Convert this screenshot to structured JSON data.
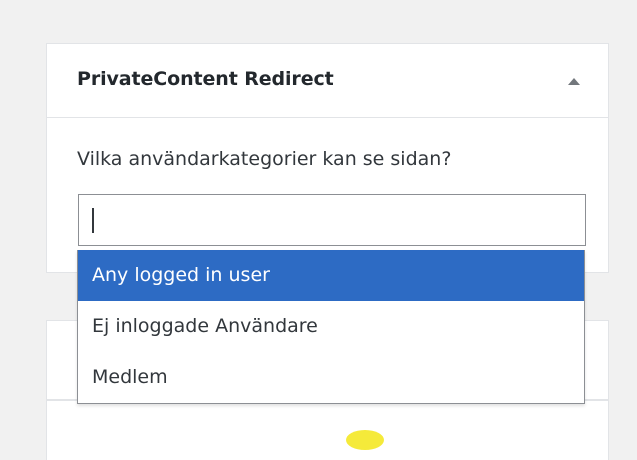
{
  "panel": {
    "title": "PrivateContent Redirect",
    "toggle_icon": "triangle-up-icon"
  },
  "field": {
    "question": "Vilka användarkategorier kan se sidan?",
    "search_value": ""
  },
  "dropdown": {
    "options": [
      {
        "label": "Any logged in user",
        "highlighted": true
      },
      {
        "label": "Ej inloggade Användare",
        "highlighted": false
      },
      {
        "label": "Medlem",
        "highlighted": false
      }
    ]
  },
  "colors": {
    "highlight": "#2d6bc4",
    "background": "#f1f1f1"
  }
}
